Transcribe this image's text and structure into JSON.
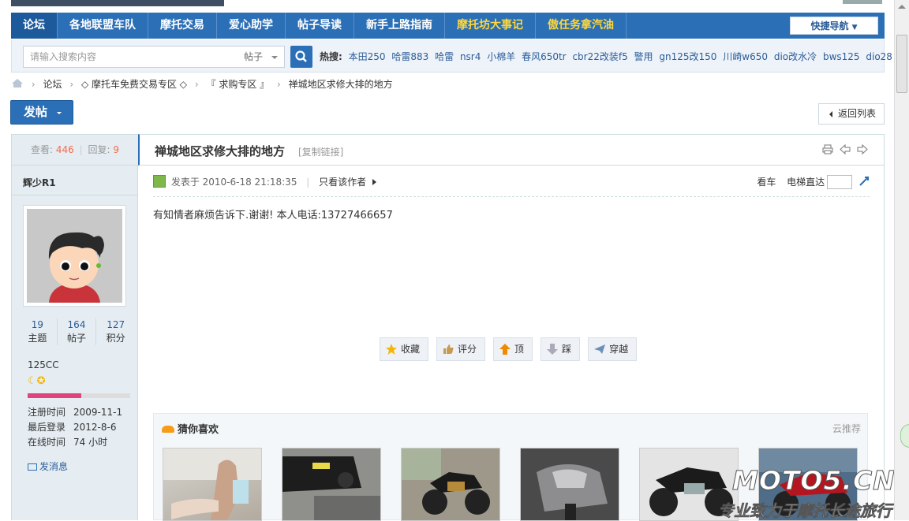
{
  "nav": {
    "items": [
      "论坛",
      "各地联盟车队",
      "摩托交易",
      "爱心助学",
      "帖子导读",
      "新手上路指南",
      "摩托坊大事记",
      "傲任务拿汽油"
    ],
    "quick": "快捷导航"
  },
  "search": {
    "placeholder": "请输入搜索内容",
    "type": "帖子",
    "hot_label": "热搜:",
    "hot": [
      "本田250",
      "哈雷883",
      "哈雷",
      "nsr4",
      "小棉羊",
      "春风650tr",
      "cbr22改装f5",
      "警用",
      "gn125改150",
      "川崎w650",
      "dio改水冷",
      "bws125",
      "dio28"
    ]
  },
  "breadcrumb": [
    "论坛",
    "◇ 摩托车免费交易专区 ◇",
    "『 求购专区 』",
    "禅城地区求修大排的地方"
  ],
  "post_button": "发帖",
  "back_button": "返回列表",
  "stat": {
    "view_label": "查看:",
    "views": "446",
    "reply_label": "回复:",
    "replies": "9"
  },
  "thread": {
    "title": "禅城地区求修大排的地方",
    "copy": "[复制链接]"
  },
  "user": {
    "name": "辉少R1",
    "topics": "19",
    "topics_label": "主题",
    "posts": "164",
    "posts_label": "帖子",
    "score": "127",
    "score_label": "积分",
    "level": "125CC",
    "level_stars": "☾✪",
    "level_progress": 0.52,
    "reg_label": "注册时间",
    "reg": "2009-11-1",
    "last_label": "最后登录",
    "last": "2012-8-6",
    "online_label": "在线时间",
    "online": "74 小时",
    "msg": "发消息"
  },
  "post": {
    "pub": "发表于 2010-6-18 21:18:35",
    "only_author": "只看该作者",
    "car": "看车",
    "floor": "电梯直达",
    "content": "有知情者麻烦告诉下.谢谢! 本人电话:13727466657"
  },
  "actions": [
    "收藏",
    "评分",
    "顶",
    "踩",
    "穿越"
  ],
  "guess": {
    "title": "猜你喜欢",
    "source": "云推荐"
  },
  "watermark": {
    "big": "MOTO5.CN",
    "small": "专业致力于摩托长途旅行"
  },
  "colors": {
    "accent": "#2b6fb6",
    "highlight": "#ffd83a",
    "count": "#f26c4f"
  }
}
